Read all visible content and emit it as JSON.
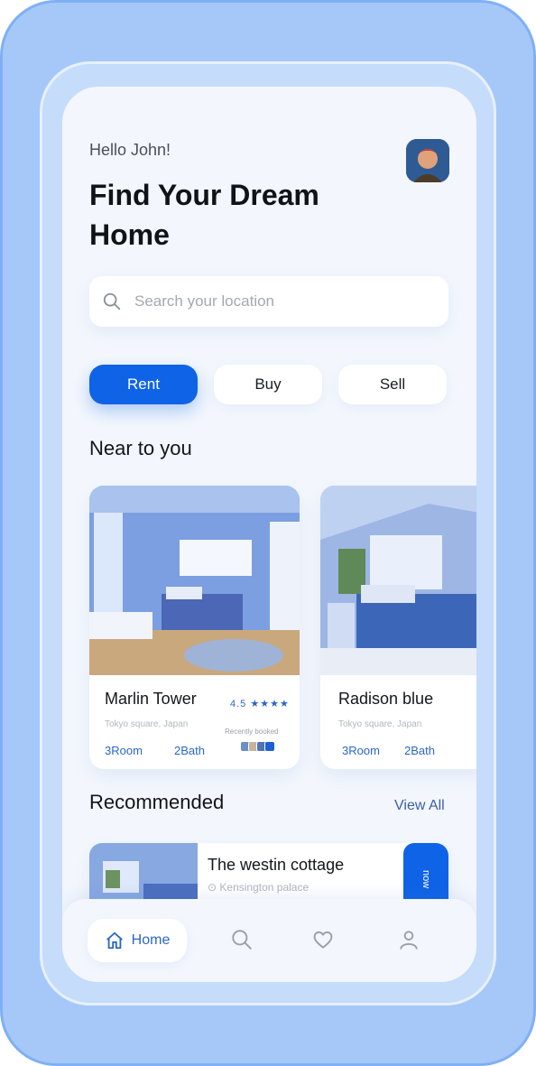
{
  "header": {
    "greeting": "Hello John!",
    "headline": "Find Your Dream Home"
  },
  "search": {
    "placeholder": "Search your location"
  },
  "tabs": [
    {
      "label": "Rent",
      "active": true
    },
    {
      "label": "Buy",
      "active": false
    },
    {
      "label": "Sell",
      "active": false
    }
  ],
  "near": {
    "title": "Near to you",
    "cards": [
      {
        "name": "Marlin Tower",
        "location": "Tokyo square, Japan",
        "rooms": "3Room",
        "baths": "2Bath",
        "rating": "4.5",
        "stars": "★★★★",
        "recent_label": "Recently booked"
      },
      {
        "name": "Radison blue",
        "location": "Tokyo square, Japan",
        "rooms": "3Room",
        "baths": "2Bath"
      }
    ]
  },
  "recommended": {
    "title": "Recommended",
    "view_all": "View All",
    "items": [
      {
        "name": "The westin cottage",
        "location": "Kensington palace",
        "button": "now"
      }
    ]
  },
  "nav": {
    "home_label": "Home"
  },
  "colors": {
    "accent": "#0f63e6",
    "frame": "#a6c8f8",
    "background": "#f3f7fd"
  }
}
